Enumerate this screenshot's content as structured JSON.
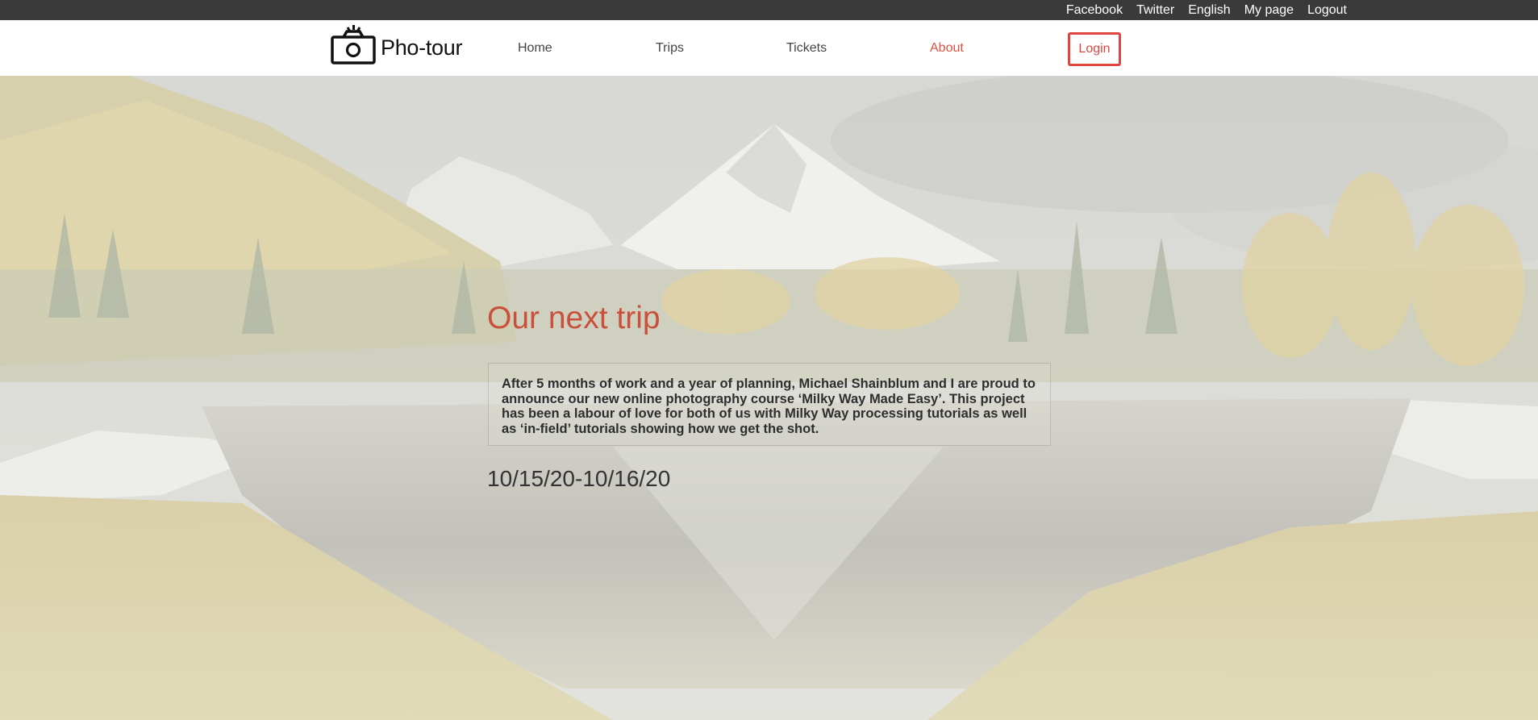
{
  "topbar": {
    "links": [
      "Facebook",
      "Twitter",
      "English",
      "My page",
      "Logout"
    ]
  },
  "header": {
    "logo_text": "Pho-tour",
    "logo_icon": "camera-icon",
    "nav": [
      {
        "label": "Home",
        "active": false
      },
      {
        "label": "Trips",
        "active": false
      },
      {
        "label": "Tickets",
        "active": false
      },
      {
        "label": "About",
        "active": true
      }
    ],
    "login_label": "Login"
  },
  "hero": {
    "title": "Our next trip",
    "description": "After 5 months of work and a year of planning, Michael Shainblum and I are proud to announce our new online photography course ‘Milky Way Made Easy’. This project has been a labour of love for both of us with Milky Way processing tutorials as well as ‘in-field’ tutorials showing how we get the shot.",
    "dates": "10/15/20-10/16/20"
  },
  "colors": {
    "topbar_bg": "#3a3a3a",
    "accent": "#e0463f",
    "title": "#c9503a"
  }
}
